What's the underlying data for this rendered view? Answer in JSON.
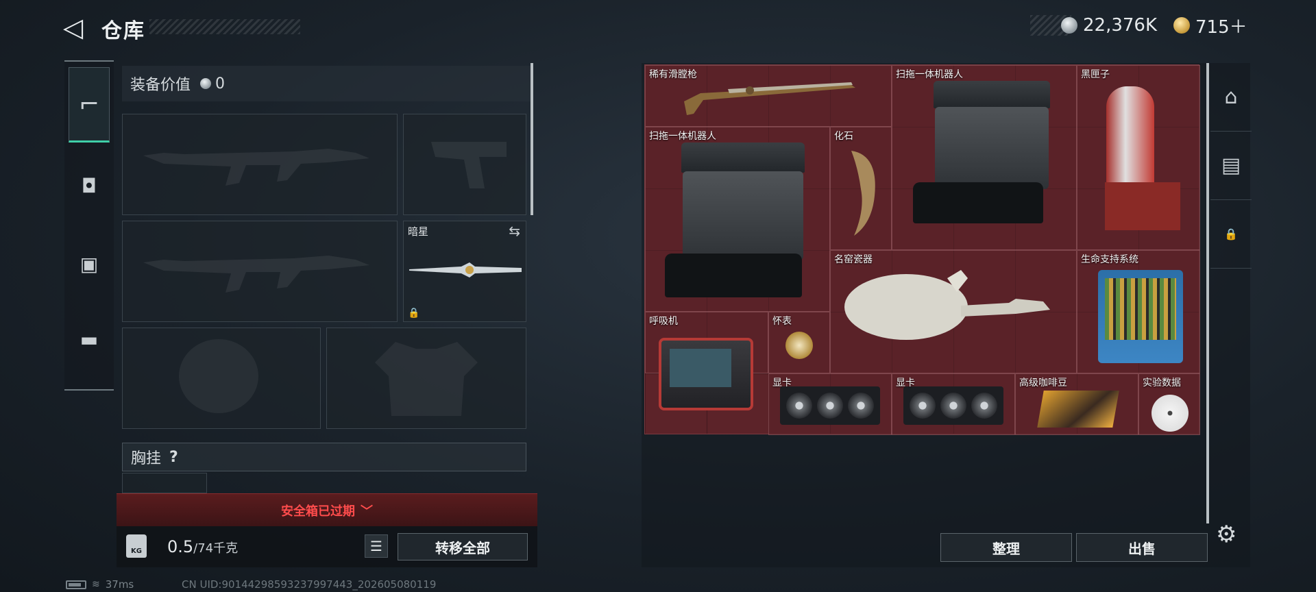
{
  "header": {
    "back_glyph": "◁",
    "title": "仓库",
    "currency_silver": "22,376K",
    "currency_gold": "715＋"
  },
  "left_nav": {
    "items": [
      {
        "icon": "pistol-icon",
        "glyph": "⌐",
        "active": true
      },
      {
        "icon": "backpack-icon",
        "glyph": "◘",
        "active": false
      },
      {
        "icon": "vest-icon",
        "glyph": "▣",
        "active": false
      },
      {
        "icon": "briefcase-icon",
        "glyph": "▬",
        "active": false
      }
    ]
  },
  "equipment": {
    "value_label": "装备价值",
    "value": "0",
    "melee_slot_label": "暗星",
    "swap_glyph": "⇆",
    "lock_glyph": "🔒",
    "chest_rig_label": "胸挂",
    "chest_rig_help": "?"
  },
  "safe_box": {
    "expired_text": "安全箱已过期",
    "chevron": "﹀"
  },
  "bottom": {
    "kg_icon_text": "KG",
    "weight_current": "0.5",
    "weight_max": "/74千克",
    "list_glyph": "☰",
    "transfer_all": "转移全部"
  },
  "status": {
    "ping": "37ms",
    "uid": "CN UID:9014429859323799744​3_202605080119"
  },
  "stash_items": [
    {
      "label": "稀有滑膛枪"
    },
    {
      "label": "扫拖一体机器人"
    },
    {
      "label": "黑匣子"
    },
    {
      "label": "扫拖一体机器人"
    },
    {
      "label": "化石"
    },
    {
      "label": "名窑瓷器"
    },
    {
      "label": "生命支持系统"
    },
    {
      "label": "呼吸机"
    },
    {
      "label": "怀表"
    },
    {
      "label": "显卡"
    },
    {
      "label": "显卡"
    },
    {
      "label": "高级咖啡豆"
    },
    {
      "label": "实验数据"
    }
  ],
  "right_nav": {
    "items": [
      {
        "icon": "safe-icon",
        "glyph": "⌂"
      },
      {
        "icon": "stash-level-icon",
        "glyph": "▤"
      },
      {
        "icon": "lock-icon",
        "glyph": "🔒"
      }
    ]
  },
  "actions": {
    "organize": "整理",
    "sell": "出售",
    "settings_glyph": "⚙"
  }
}
